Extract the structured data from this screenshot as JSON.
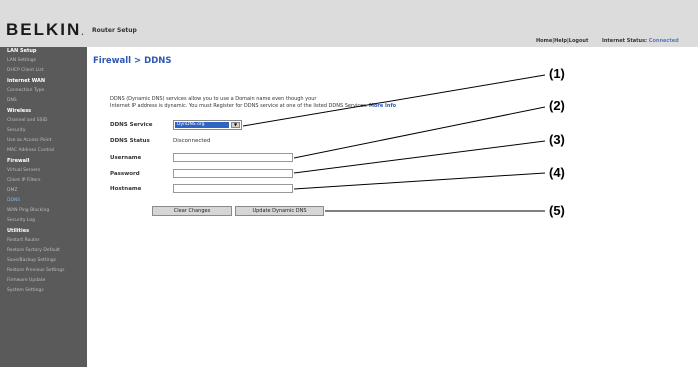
{
  "header": {
    "logo": "BELKIN",
    "logo_suffix": ".",
    "router_setup": "Router Setup",
    "home": "Home",
    "sep1": "|",
    "help": "Help",
    "sep2": "|",
    "logout": "Logout",
    "inet_label": "Internet Status:",
    "inet_value": "Connected"
  },
  "sidebar": {
    "lan_setup": "LAN Setup",
    "lan_settings": "LAN Settings",
    "dhcp_client_list": "DHCP Client List",
    "internet_wan": "Internet WAN",
    "connection_type": "Connection Type",
    "dns": "DNS",
    "wireless": "Wireless",
    "channel_ssid": "Channel and SSID",
    "security": "Security",
    "use_as_access_point": "Use as Access Point",
    "mac_address_control": "MAC Address Control",
    "firewall": "Firewall",
    "virtual_servers": "Virtual Servers",
    "client_ip_filters": "Client IP Filters",
    "dmz": "DMZ",
    "ddns": "DDNS",
    "wan_ping_blocking": "WAN Ping Blocking",
    "security_log": "Security Log",
    "utilities": "Utilities",
    "restart_router": "Restart Router",
    "restore_factory_default": "Restore Factory Default",
    "save_backup_settings": "Save/Backup Settings",
    "restore_previous_settings": "Restore Previous Settings",
    "firmware_update": "Firmware Update",
    "system_settings": "System Settings"
  },
  "main": {
    "title": "Firewall > DDNS",
    "desc_line1": "DDNS (Dynamic DNS) services allow you to use a Domain name even though your",
    "desc_line2": "Internet IP address is dynamic. You must Register for DDNS service at one of the listed DDNS Services.",
    "more_info": "More Info",
    "ddns_service_label": "DDNS Service",
    "ddns_service_value": "DynDNS.org",
    "ddns_status_label": "DDNS Status",
    "ddns_status_value": "Disconnected",
    "username_label": "Username",
    "password_label": "Password",
    "hostname_label": "Hostname",
    "username_value": "",
    "password_value": "",
    "hostname_value": "",
    "clear_button": "Clear Changes",
    "update_button": "Update Dynamic DNS"
  },
  "callouts": {
    "c1": "(1)",
    "c2": "(2)",
    "c3": "(3)",
    "c4": "(4)",
    "c5": "(5)"
  }
}
